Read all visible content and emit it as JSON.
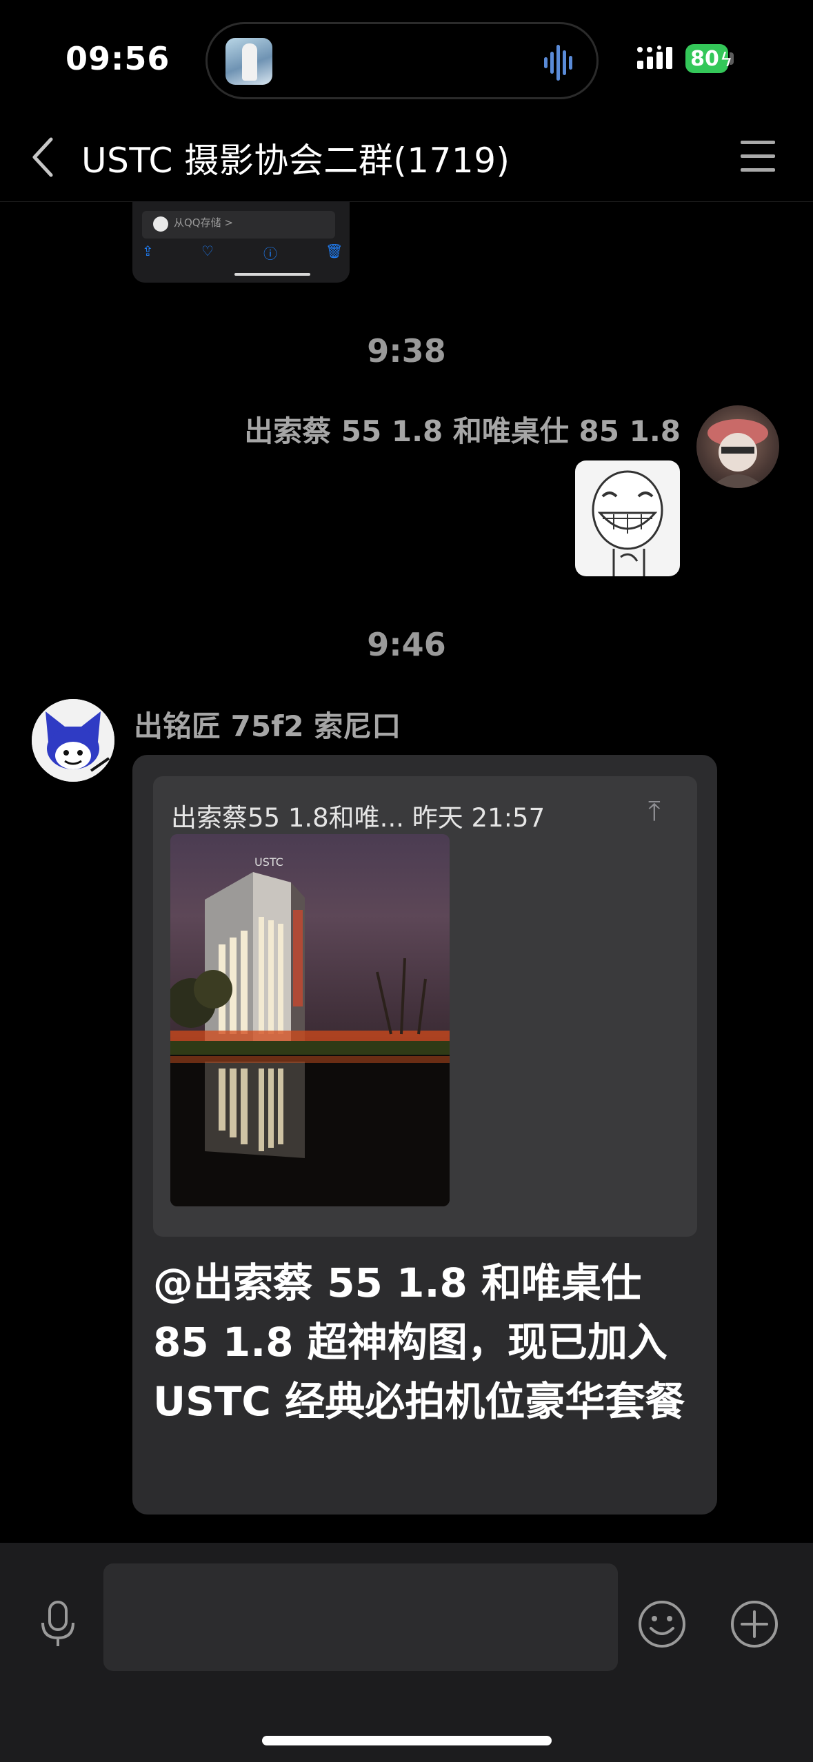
{
  "status_bar": {
    "time": "09:56",
    "battery": "80"
  },
  "nav": {
    "title": "USTC 摄影协会二群(1719)"
  },
  "messages": {
    "partial_image": {
      "source_label": "从QQ存储 >"
    },
    "timestamp_1": "9:38",
    "outgoing": {
      "sender": "出索蔡 55 1.8 和唯桌仕 85 1.8",
      "content_type": "sticker"
    },
    "timestamp_2": "9:46",
    "incoming": {
      "sender": "出铭匠 75f2 索尼口",
      "reply_header": "出索蔡55 1.8和唯... 昨天 21:57",
      "photo_building_label": "USTC",
      "text": "@出索蔡 55 1.8 和唯桌仕 85 1.8 超神构图，现已加入 USTC 经典必拍机位豪华套餐"
    }
  },
  "input": {
    "placeholder": ""
  },
  "colors": {
    "background": "#000000",
    "bubble": "#2c2c2e",
    "reply_card": "#3a3a3c",
    "battery": "#34c759",
    "input_bar": "#1c1c1e"
  },
  "icons": [
    "back-chevron-icon",
    "menu-icon",
    "mic-icon",
    "emoji-icon",
    "plus-circle-icon",
    "waveform-icon",
    "signal-icon",
    "pin-top-icon"
  ]
}
